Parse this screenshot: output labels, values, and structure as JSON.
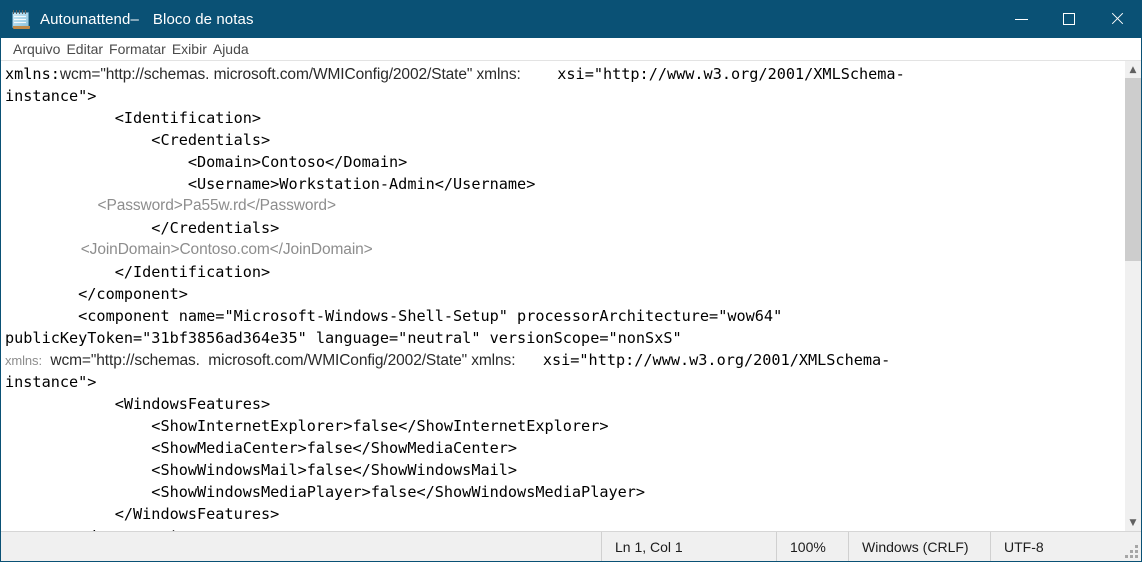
{
  "window": {
    "document_name": "Autounattend",
    "dash": "–",
    "app_name": "Bloco de notas",
    "app_icon": "notepad-icon",
    "controls": {
      "minimize": "minimize-icon",
      "maximize": "maximize-icon",
      "close": "close-icon"
    },
    "titlebar_color": "#0a5175"
  },
  "menu": {
    "items": [
      {
        "label": "Arquivo"
      },
      {
        "label": "Editar"
      },
      {
        "label": "Formatar"
      },
      {
        "label": "Exibir"
      },
      {
        "label": "Ajuda"
      }
    ]
  },
  "editor": {
    "lines": [
      {
        "id": "line-1",
        "style": "mixed",
        "runs": [
          {
            "text": "xmlns:",
            "style": "mono"
          },
          {
            "text": "wcm=\"http://schemas. microsoft.com/WMIConfig/2002/State\" xmlns:",
            "style": "sans"
          },
          {
            "text": "    xsi=\"http://www.w3.org/2001/XMLSchema-",
            "style": "mono"
          }
        ]
      },
      {
        "id": "line-2",
        "style": "mono",
        "text": "instance\">"
      },
      {
        "id": "line-3",
        "style": "mono",
        "text": "            <Identification>"
      },
      {
        "id": "line-4",
        "style": "mono",
        "text": "                <Credentials>"
      },
      {
        "id": "line-5",
        "style": "mono",
        "text": "                    <Domain>Contoso</Domain>"
      },
      {
        "id": "line-6",
        "style": "mono",
        "text": "                    <Username>Workstation-Admin</Username>"
      },
      {
        "id": "line-7",
        "style": "gray",
        "text": "                      <Password>Pa55w.rd</Password>"
      },
      {
        "id": "line-8",
        "style": "mono",
        "text": "                </Credentials>"
      },
      {
        "id": "line-9",
        "style": "gray",
        "text": "                  <JoinDomain>Contoso.com</JoinDomain>"
      },
      {
        "id": "line-10",
        "style": "mono",
        "text": "            </Identification>"
      },
      {
        "id": "line-11",
        "style": "mono",
        "text": "        </component>"
      },
      {
        "id": "line-12",
        "style": "mono",
        "text": "        <component name=\"Microsoft-Windows-Shell-Setup\" processorArchitecture=\"wow64\""
      },
      {
        "id": "line-13",
        "style": "mono",
        "text": "publicKeyToken=\"31bf3856ad364e35\" language=\"neutral\" versionScope=\"nonSxS\""
      },
      {
        "id": "line-14",
        "style": "mixed",
        "runs": [
          {
            "text": "xmlns:",
            "style": "graysm"
          },
          {
            "text": "  wcm=\"http://schemas.  microsoft.com/WMIConfig/2002/State\" xmlns:",
            "style": "sans"
          },
          {
            "text": "   xsi=\"http://www.w3.org/2001/XMLSchema-",
            "style": "mono"
          }
        ]
      },
      {
        "id": "line-15",
        "style": "mono",
        "text": "instance\">"
      },
      {
        "id": "line-16",
        "style": "mono",
        "text": "            <WindowsFeatures>"
      },
      {
        "id": "line-17",
        "style": "mono",
        "text": "                <ShowInternetExplorer>false</ShowInternetExplorer>"
      },
      {
        "id": "line-18",
        "style": "mono",
        "text": "                <ShowMediaCenter>false</ShowMediaCenter>"
      },
      {
        "id": "line-19",
        "style": "mono",
        "text": "                <ShowWindowsMail>false</ShowWindowsMail>"
      },
      {
        "id": "line-20",
        "style": "mono",
        "text": "                <ShowWindowsMediaPlayer>false</ShowWindowsMediaPlayer>"
      },
      {
        "id": "line-21",
        "style": "mono",
        "text": "            </WindowsFeatures>"
      },
      {
        "id": "line-22",
        "style": "mono",
        "text": "        </component>"
      }
    ]
  },
  "scrollbar": {
    "up_arrow": "chevron-up-icon",
    "down_arrow": "chevron-down-icon"
  },
  "statusbar": {
    "cursor_position": "Ln 1, Col 1",
    "zoom": "100%",
    "line_endings": "Windows (CRLF)",
    "encoding": "UTF-8",
    "resize_grip": "resize-grip-icon"
  }
}
